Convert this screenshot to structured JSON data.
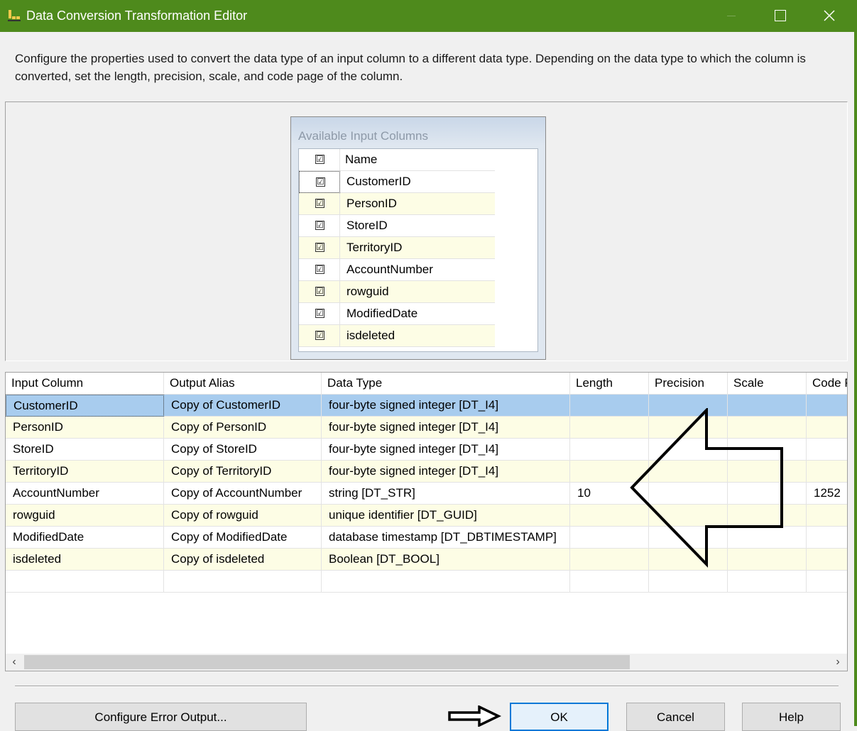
{
  "window": {
    "title": "Data Conversion Transformation Editor"
  },
  "description": "Configure the properties used to convert the data type of an input column to a different data type. Depending on the data type to which the column is converted, set the length, precision, scale, and code page of the column.",
  "available_input_columns": {
    "title": "Available Input Columns",
    "header": "Name",
    "items": [
      {
        "name": "CustomerID",
        "checked": true
      },
      {
        "name": "PersonID",
        "checked": true
      },
      {
        "name": "StoreID",
        "checked": true
      },
      {
        "name": "TerritoryID",
        "checked": true
      },
      {
        "name": "AccountNumber",
        "checked": true
      },
      {
        "name": "rowguid",
        "checked": true
      },
      {
        "name": "ModifiedDate",
        "checked": true
      },
      {
        "name": "isdeleted",
        "checked": true
      }
    ]
  },
  "grid": {
    "columns": [
      "Input Column",
      "Output Alias",
      "Data Type",
      "Length",
      "Precision",
      "Scale",
      "Code P"
    ],
    "rows": [
      [
        "CustomerID",
        "Copy of CustomerID",
        "four-byte signed integer [DT_I4]",
        "",
        "",
        "",
        ""
      ],
      [
        "PersonID",
        "Copy of PersonID",
        "four-byte signed integer [DT_I4]",
        "",
        "",
        "",
        ""
      ],
      [
        "StoreID",
        "Copy of StoreID",
        "four-byte signed integer [DT_I4]",
        "",
        "",
        "",
        ""
      ],
      [
        "TerritoryID",
        "Copy of TerritoryID",
        "four-byte signed integer [DT_I4]",
        "",
        "",
        "",
        ""
      ],
      [
        "AccountNumber",
        "Copy of AccountNumber",
        "string [DT_STR]",
        "10",
        "",
        "",
        "1252"
      ],
      [
        "rowguid",
        "Copy of rowguid",
        "unique identifier [DT_GUID]",
        "",
        "",
        "",
        ""
      ],
      [
        "ModifiedDate",
        "Copy of ModifiedDate",
        "database timestamp [DT_DBTIMESTAMP]",
        "",
        "",
        "",
        ""
      ],
      [
        "isdeleted",
        "Copy of isdeleted",
        "Boolean [DT_BOOL]",
        "",
        "",
        "",
        ""
      ]
    ]
  },
  "buttons": {
    "configure_error_output": "Configure Error Output...",
    "ok": "OK",
    "cancel": "Cancel",
    "help": "Help"
  },
  "icons": {
    "checkbox_glyph": "☑",
    "scroll_left": "‹",
    "scroll_right": "›"
  },
  "colors": {
    "titlebar": "#4e8a1c",
    "row_alt": "#fdfde5",
    "row_selected": "#a8ccee",
    "ok_border": "#0078d7"
  }
}
